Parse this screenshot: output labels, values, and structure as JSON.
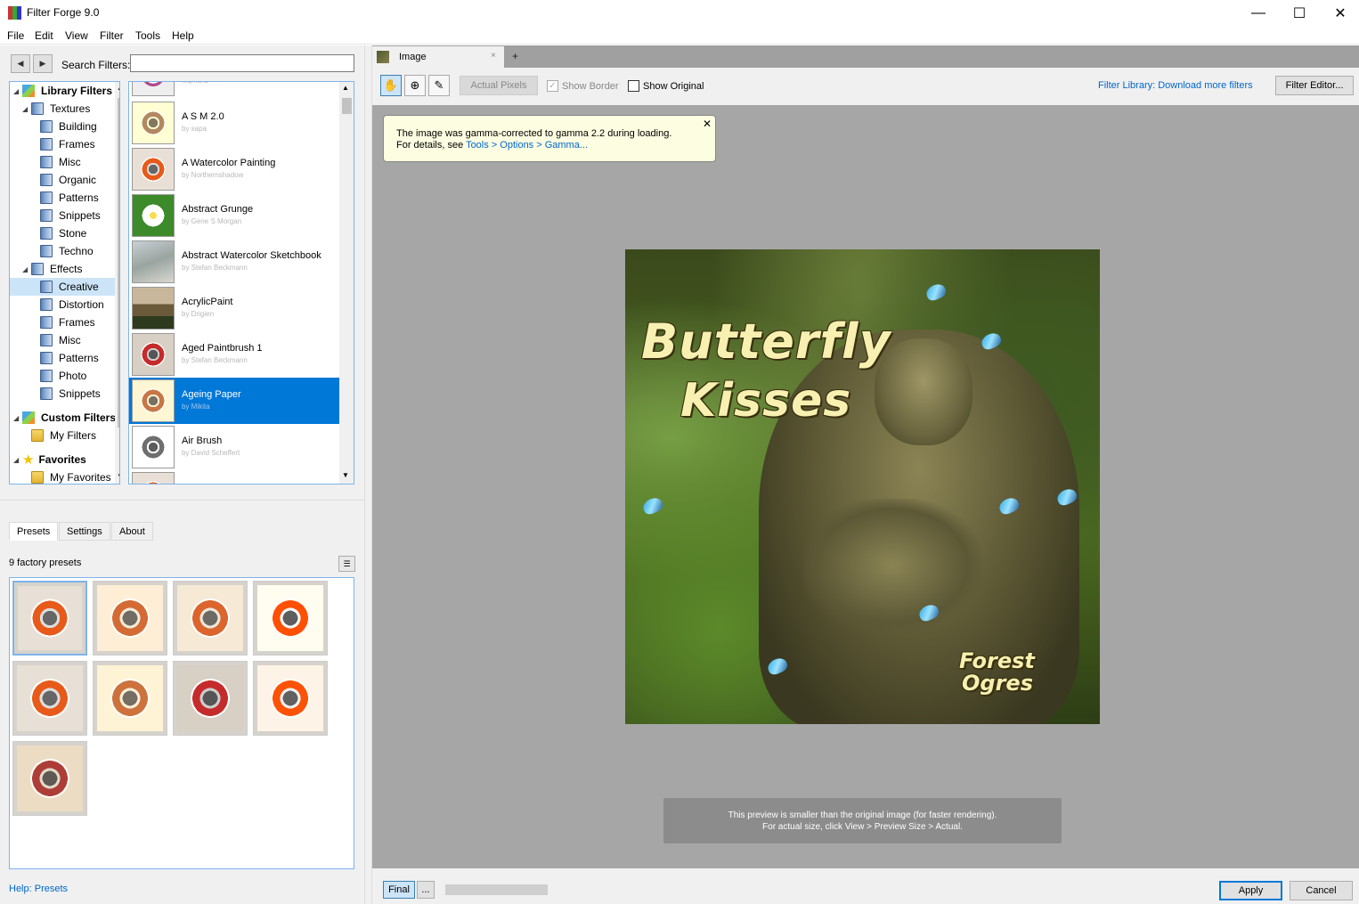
{
  "window": {
    "title": "Filter Forge 9.0",
    "minimize": "—",
    "maximize": "☐",
    "close": "✕"
  },
  "menu": [
    "File",
    "Edit",
    "View",
    "Filter",
    "Tools",
    "Help"
  ],
  "search": {
    "label": "Search Filters:",
    "value": ""
  },
  "tree": [
    {
      "label": "Library Filters",
      "bold": true,
      "icon": "cube-icon"
    },
    {
      "label": "Textures",
      "icon": "folder-icon"
    },
    {
      "label": "Building",
      "icon": "folder-icon"
    },
    {
      "label": "Frames",
      "icon": "folder-icon"
    },
    {
      "label": "Misc",
      "icon": "folder-icon"
    },
    {
      "label": "Organic",
      "icon": "folder-icon"
    },
    {
      "label": "Patterns",
      "icon": "folder-icon"
    },
    {
      "label": "Snippets",
      "icon": "folder-icon"
    },
    {
      "label": "Stone",
      "icon": "folder-icon"
    },
    {
      "label": "Techno",
      "icon": "folder-icon"
    },
    {
      "label": "Effects",
      "icon": "folder-icon"
    },
    {
      "label": "Creative",
      "icon": "folder-icon",
      "selected": true
    },
    {
      "label": "Distortion",
      "icon": "folder-icon"
    },
    {
      "label": "Frames",
      "icon": "folder-icon"
    },
    {
      "label": "Misc",
      "icon": "folder-icon"
    },
    {
      "label": "Patterns",
      "icon": "folder-icon"
    },
    {
      "label": "Photo",
      "icon": "folder-icon"
    },
    {
      "label": "Snippets",
      "icon": "folder-icon"
    },
    {
      "label": "Custom Filters",
      "bold": true,
      "icon": "cube-icon"
    },
    {
      "label": "My Filters",
      "icon": "yellow-folder-icon"
    },
    {
      "label": "Favorites",
      "bold": true,
      "icon": "star-icon"
    },
    {
      "label": "My Favorites",
      "icon": "yellow-folder-icon"
    }
  ],
  "filters": [
    {
      "name": "",
      "author": "loqmanz"
    },
    {
      "name": "A S M  2.0",
      "author": "by sapa"
    },
    {
      "name": "A Watercolor Painting",
      "author": "by Northernshadow"
    },
    {
      "name": "Abstract Grunge",
      "author": "by Gene S Morgan"
    },
    {
      "name": "Abstract Watercolor Sketchbook",
      "author": "by Stefan Beckmann"
    },
    {
      "name": "AcrylicPaint",
      "author": "by Drigien"
    },
    {
      "name": "Aged Paintbrush 1",
      "author": "by Stefan Beckmann"
    },
    {
      "name": "Ageing Paper",
      "author": "by Mikita",
      "selected": true
    },
    {
      "name": "Air Brush",
      "author": "by David Scheffert"
    }
  ],
  "tabs": [
    "Presets",
    "Settings",
    "About"
  ],
  "presets": {
    "count_label": "9 factory presets",
    "count": 9,
    "menu_icon": "list-icon"
  },
  "help": "Help: Presets",
  "image_tab": {
    "label": "Image",
    "close": "×",
    "new": "+"
  },
  "toolbar": {
    "tools": [
      "hand-icon",
      "zoom-icon",
      "eyedropper-icon"
    ],
    "actual_pixels": "Actual Pixels",
    "show_border": "Show Border",
    "show_original": "Show Original",
    "library_link": "Filter Library: Download more filters",
    "filter_editor": "Filter Editor..."
  },
  "notice": {
    "line1": "The image was gamma-corrected to gamma 2.2 during loading.",
    "line2_prefix": "For details, see ",
    "line2_link": "Tools > Options > Gamma...",
    "close": "✕"
  },
  "artwork": {
    "title1": "Butterfly",
    "title2": "Kisses",
    "sub1": "Forest",
    "sub2": "Ogres"
  },
  "size_notice": {
    "line1": "This preview is smaller than the original image (for faster rendering).",
    "line2": "For actual size, click View > Preview Size > Actual."
  },
  "bottom": {
    "final": "Final",
    "more": "...",
    "apply": "Apply",
    "cancel": "Cancel"
  }
}
